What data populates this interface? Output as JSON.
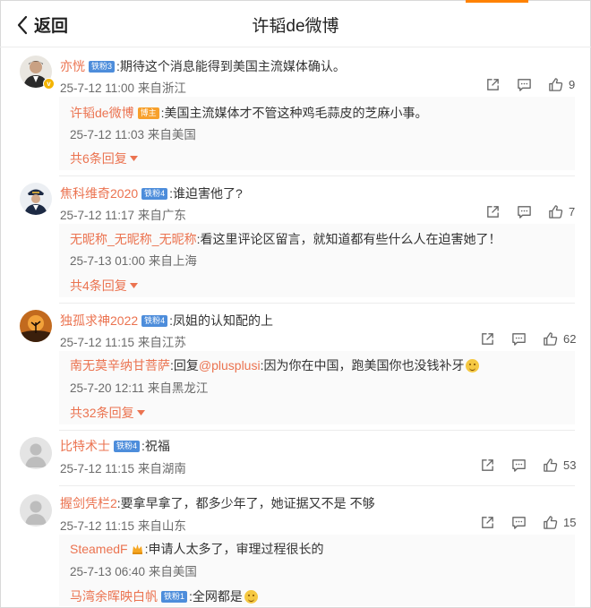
{
  "header": {
    "back_label": "返回",
    "title": "许韬de微博"
  },
  "comments": [
    {
      "user": "亦恍",
      "fan": "铁粉3",
      "text": ":期待这个消息能得到美国主流媒体确认。",
      "meta": "25-7-12 11:00 来自浙江",
      "likes": "9",
      "reply": {
        "user": "许韬de微博",
        "badge": "博主",
        "text": ":美国主流媒体才不管这种鸡毛蒜皮的芝麻小事。",
        "meta": "25-7-12 11:03 来自美国"
      },
      "more": "共6条回复"
    },
    {
      "user": "焦科维奇2020",
      "fan": "铁粉4",
      "text": ":谁迫害他了?",
      "meta": "25-7-12 11:17 来自广东",
      "likes": "7",
      "reply": {
        "user": "无昵称_无昵称_无昵称",
        "text": ":看这里评论区留言，就知道都有些什么人在迫害她了！",
        "meta": "25-7-13 01:00 来自上海"
      },
      "more": "共4条回复"
    },
    {
      "user": "独孤求神2022",
      "fan": "铁粉4",
      "text": ":凤姐的认知配的上",
      "meta": "25-7-12 11:15 来自江苏",
      "likes": "62",
      "reply": {
        "user": "南无莫辛纳甘菩萨",
        "pre": ":回复",
        "mention": "@plusplusi",
        "text": ":因为你在中国，跑美国你也没钱补牙",
        "meta": "25-7-20 12:11 来自黑龙江"
      },
      "more": "共32条回复"
    },
    {
      "user": "比特术士",
      "fan": "铁粉4",
      "text": ":祝福",
      "meta": "25-7-12 11:15 来自湖南",
      "likes": "53"
    },
    {
      "user": "握剑凭栏2",
      "text": ":要拿早拿了，都多少年了，她证据又不是 不够",
      "meta": "25-7-12 11:15 来自山东",
      "likes": "15",
      "reply": {
        "user": "SteamedF",
        "text": ":申请人太多了，审理过程很长的",
        "meta": "25-7-13 06:40 来自美国"
      },
      "reply2": {
        "user": "马湾余晖映白帆",
        "fan": "铁粉1",
        "text": ":全网都是"
      }
    }
  ],
  "icons": {
    "share": "share-icon",
    "comment": "comment-icon",
    "like": "like-icon"
  },
  "colors": {
    "username": "#eb7350",
    "fan_badge": "#4d8ddb",
    "author_badge": "#f7a02c",
    "accent": "#ff8200"
  }
}
